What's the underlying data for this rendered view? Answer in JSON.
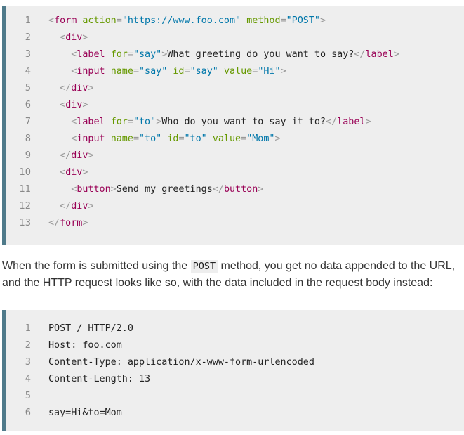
{
  "code_block_1": {
    "lines": [
      {
        "n": "1",
        "tokens": [
          [
            "punc",
            "<"
          ],
          [
            "tag",
            "form"
          ],
          [
            "text",
            " "
          ],
          [
            "attr",
            "action"
          ],
          [
            "punc",
            "="
          ],
          [
            "val",
            "\"https://www.foo.com\""
          ],
          [
            "text",
            " "
          ],
          [
            "attr",
            "method"
          ],
          [
            "punc",
            "="
          ],
          [
            "val",
            "\"POST\""
          ],
          [
            "punc",
            ">"
          ]
        ]
      },
      {
        "n": "2",
        "tokens": [
          [
            "text",
            "  "
          ],
          [
            "punc",
            "<"
          ],
          [
            "tag",
            "div"
          ],
          [
            "punc",
            ">"
          ]
        ]
      },
      {
        "n": "3",
        "tokens": [
          [
            "text",
            "    "
          ],
          [
            "punc",
            "<"
          ],
          [
            "tag",
            "label"
          ],
          [
            "text",
            " "
          ],
          [
            "attr",
            "for"
          ],
          [
            "punc",
            "="
          ],
          [
            "val",
            "\"say\""
          ],
          [
            "punc",
            ">"
          ],
          [
            "text",
            "What greeting do you want to say?"
          ],
          [
            "punc",
            "</"
          ],
          [
            "tag",
            "label"
          ],
          [
            "punc",
            ">"
          ]
        ]
      },
      {
        "n": "4",
        "tokens": [
          [
            "text",
            "    "
          ],
          [
            "punc",
            "<"
          ],
          [
            "tag",
            "input"
          ],
          [
            "text",
            " "
          ],
          [
            "attr",
            "name"
          ],
          [
            "punc",
            "="
          ],
          [
            "val",
            "\"say\""
          ],
          [
            "text",
            " "
          ],
          [
            "attr",
            "id"
          ],
          [
            "punc",
            "="
          ],
          [
            "val",
            "\"say\""
          ],
          [
            "text",
            " "
          ],
          [
            "attr",
            "value"
          ],
          [
            "punc",
            "="
          ],
          [
            "val",
            "\"Hi\""
          ],
          [
            "punc",
            ">"
          ]
        ]
      },
      {
        "n": "5",
        "tokens": [
          [
            "text",
            "  "
          ],
          [
            "punc",
            "</"
          ],
          [
            "tag",
            "div"
          ],
          [
            "punc",
            ">"
          ]
        ]
      },
      {
        "n": "6",
        "tokens": [
          [
            "text",
            "  "
          ],
          [
            "punc",
            "<"
          ],
          [
            "tag",
            "div"
          ],
          [
            "punc",
            ">"
          ]
        ]
      },
      {
        "n": "7",
        "tokens": [
          [
            "text",
            "    "
          ],
          [
            "punc",
            "<"
          ],
          [
            "tag",
            "label"
          ],
          [
            "text",
            " "
          ],
          [
            "attr",
            "for"
          ],
          [
            "punc",
            "="
          ],
          [
            "val",
            "\"to\""
          ],
          [
            "punc",
            ">"
          ],
          [
            "text",
            "Who do you want to say it to?"
          ],
          [
            "punc",
            "</"
          ],
          [
            "tag",
            "label"
          ],
          [
            "punc",
            ">"
          ]
        ]
      },
      {
        "n": "8",
        "tokens": [
          [
            "text",
            "    "
          ],
          [
            "punc",
            "<"
          ],
          [
            "tag",
            "input"
          ],
          [
            "text",
            " "
          ],
          [
            "attr",
            "name"
          ],
          [
            "punc",
            "="
          ],
          [
            "val",
            "\"to\""
          ],
          [
            "text",
            " "
          ],
          [
            "attr",
            "id"
          ],
          [
            "punc",
            "="
          ],
          [
            "val",
            "\"to\""
          ],
          [
            "text",
            " "
          ],
          [
            "attr",
            "value"
          ],
          [
            "punc",
            "="
          ],
          [
            "val",
            "\"Mom\""
          ],
          [
            "punc",
            ">"
          ]
        ]
      },
      {
        "n": "9",
        "tokens": [
          [
            "text",
            "  "
          ],
          [
            "punc",
            "</"
          ],
          [
            "tag",
            "div"
          ],
          [
            "punc",
            ">"
          ]
        ]
      },
      {
        "n": "10",
        "tokens": [
          [
            "text",
            "  "
          ],
          [
            "punc",
            "<"
          ],
          [
            "tag",
            "div"
          ],
          [
            "punc",
            ">"
          ]
        ]
      },
      {
        "n": "11",
        "tokens": [
          [
            "text",
            "    "
          ],
          [
            "punc",
            "<"
          ],
          [
            "tag",
            "button"
          ],
          [
            "punc",
            ">"
          ],
          [
            "text",
            "Send my greetings"
          ],
          [
            "punc",
            "</"
          ],
          [
            "tag",
            "button"
          ],
          [
            "punc",
            ">"
          ]
        ]
      },
      {
        "n": "12",
        "tokens": [
          [
            "text",
            "  "
          ],
          [
            "punc",
            "</"
          ],
          [
            "tag",
            "div"
          ],
          [
            "punc",
            ">"
          ]
        ]
      },
      {
        "n": "13",
        "tokens": [
          [
            "punc",
            "</"
          ],
          [
            "tag",
            "form"
          ],
          [
            "punc",
            ">"
          ]
        ]
      }
    ]
  },
  "paragraph": {
    "before": "When the form is submitted using the ",
    "code": "POST",
    "after": " method, you get no data appended to the URL, and the HTTP request looks like so, with the data included in the request body instead:"
  },
  "code_block_2": {
    "lines": [
      {
        "n": "1",
        "text": "POST / HTTP/2.0"
      },
      {
        "n": "2",
        "text": "Host: foo.com"
      },
      {
        "n": "3",
        "text": "Content-Type: application/x-www-form-urlencoded"
      },
      {
        "n": "4",
        "text": "Content-Length: 13"
      },
      {
        "n": "5",
        "text": ""
      },
      {
        "n": "6",
        "text": "say=Hi&to=Mom"
      }
    ]
  },
  "colors": {
    "code_bg": "#eeeeee",
    "code_border": "#4f7a8a",
    "tag": "#990055",
    "attr": "#669900",
    "value": "#0077aa",
    "punctuation": "#999999"
  }
}
